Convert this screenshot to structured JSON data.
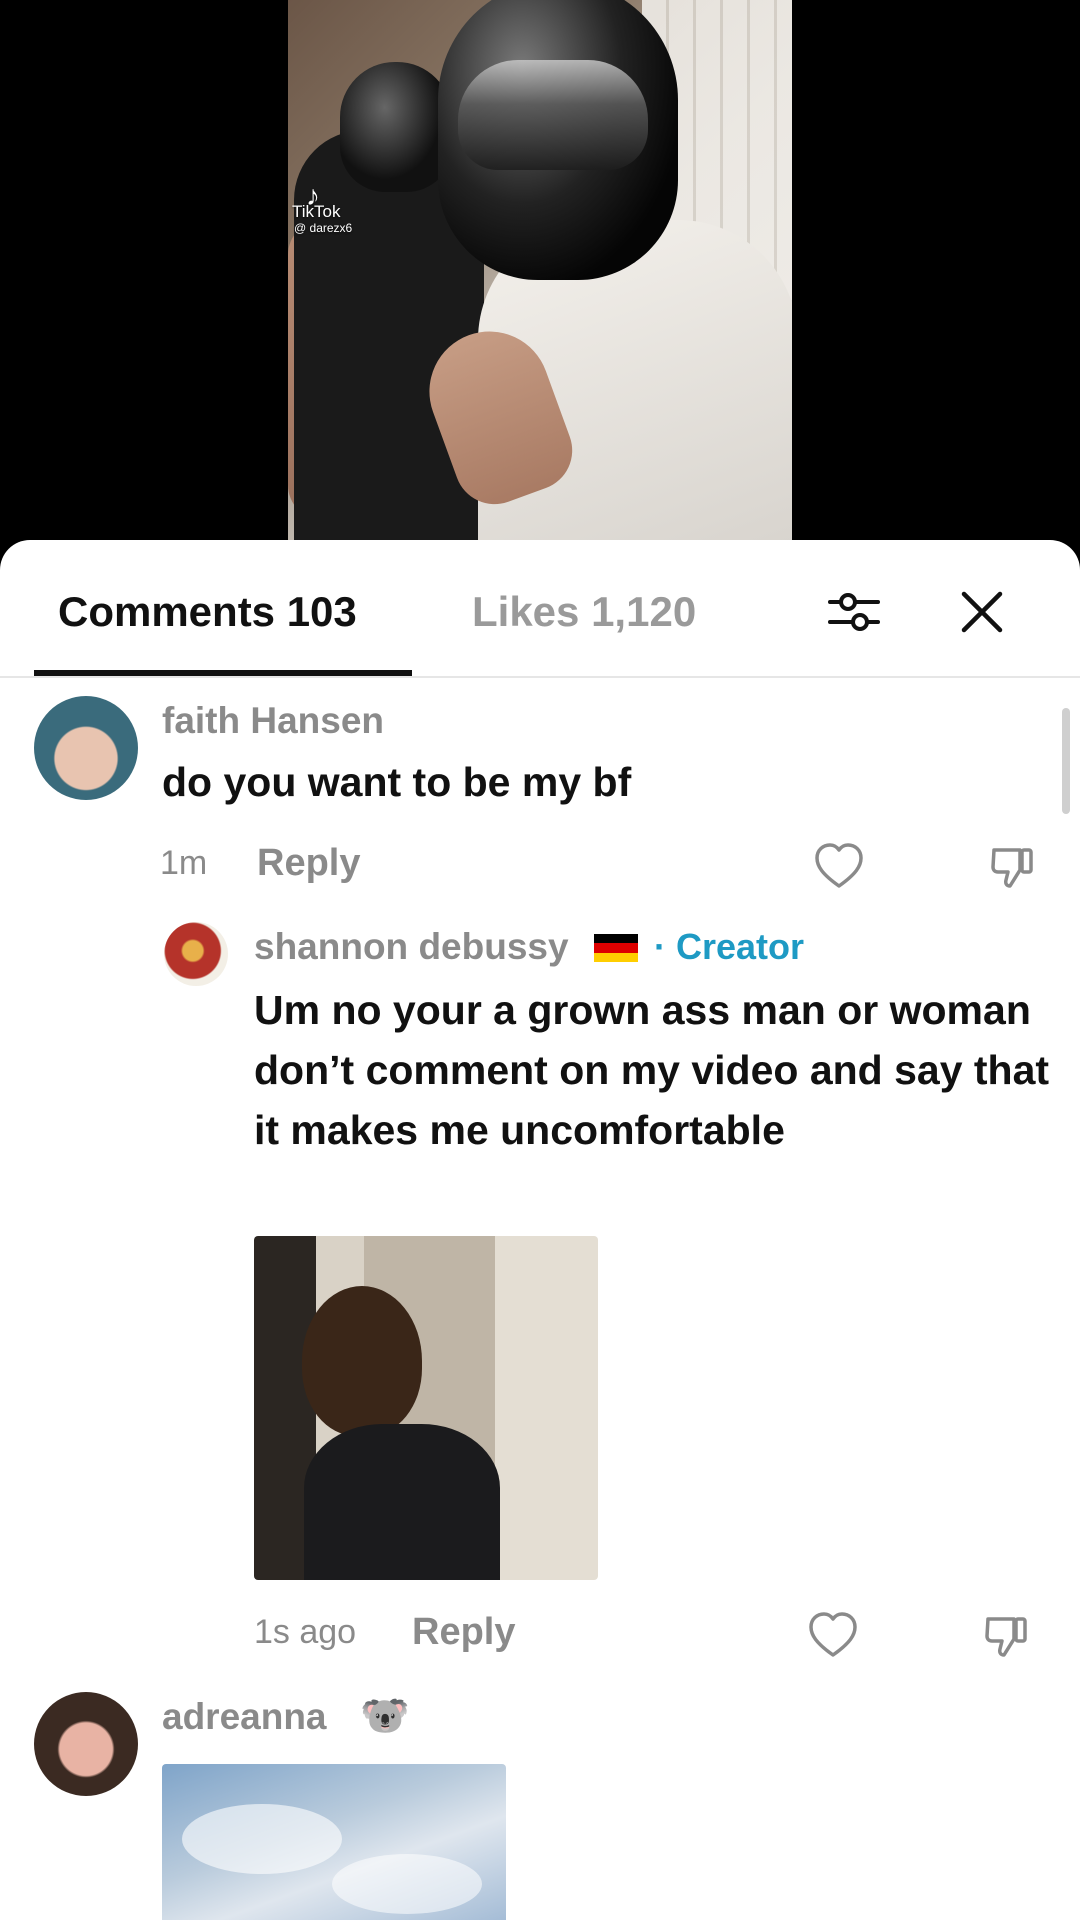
{
  "video": {
    "watermark_brand": "TikTok",
    "watermark_handle": "@ darezx6"
  },
  "panel": {
    "tabs": [
      {
        "label": "Comments 103",
        "active": true
      },
      {
        "label": "Likes 1,120",
        "active": false
      }
    ],
    "filter_icon": "sliders-icon",
    "close_icon": "close-icon"
  },
  "comments": [
    {
      "username": "faith Hansen",
      "text": "do you want to be my bf",
      "time": "1m",
      "reply_label": "Reply",
      "avatar_color": "#3a6b7c"
    },
    {
      "username": "shannon debussy",
      "badge": "· Creator",
      "text": "Um no your a grown ass man or woman don’t comment on my video and say that it makes me uncomfortable",
      "time": "1s ago",
      "reply_label": "Reply",
      "has_image": true,
      "flag": "germany"
    },
    {
      "username": "adreanna",
      "emoji": "🐨",
      "has_image": true
    }
  ],
  "colors": {
    "creator_badge": "#1e9ac4",
    "muted_text": "#8a8a8a",
    "primary_text": "#111111"
  }
}
